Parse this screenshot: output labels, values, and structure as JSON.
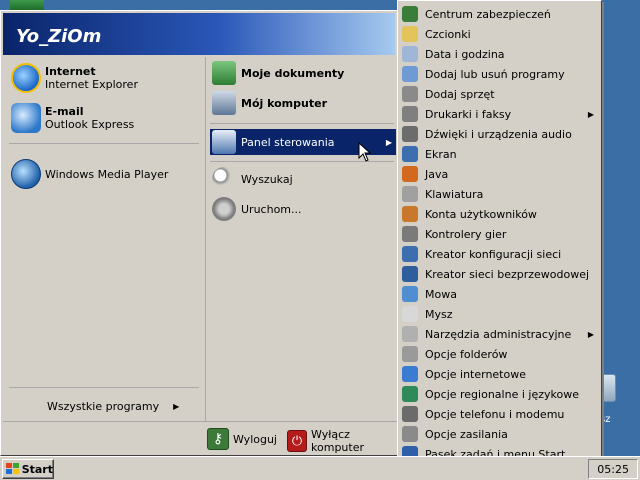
{
  "start_menu": {
    "user_name": "Yo_ZiOm",
    "pinned": [
      {
        "title": "Internet",
        "subtitle": "Internet Explorer",
        "icon": "internet-explorer-icon"
      },
      {
        "title": "E-mail",
        "subtitle": "Outlook Express",
        "icon": "outlook-express-icon"
      }
    ],
    "recent": [
      {
        "label": "Windows Media Player",
        "icon": "windows-media-player-icon"
      }
    ],
    "all_programs_label": "Wszystkie programy",
    "places": [
      {
        "label": "Moje dokumenty",
        "icon": "my-documents-icon",
        "bold": true
      },
      {
        "label": "Mój komputer",
        "icon": "my-computer-icon",
        "bold": true
      },
      {
        "label": "Panel sterowania",
        "icon": "control-panel-icon",
        "bold": false,
        "highlighted": true
      },
      {
        "label": "Wyszukaj",
        "icon": "search-icon",
        "bold": false
      },
      {
        "label": "Uruchom...",
        "icon": "run-icon",
        "bold": false
      }
    ],
    "footer": {
      "logoff_label": "Wyloguj",
      "shutdown_label": "Wyłącz komputer"
    }
  },
  "control_panel_submenu": {
    "items": [
      {
        "label": "Centrum zabezpieczeń",
        "icon": "security-center-icon",
        "color": "#3a7d3a",
        "has_submenu": false
      },
      {
        "label": "Czcionki",
        "icon": "fonts-folder-icon",
        "color": "#e3c45a",
        "has_submenu": false
      },
      {
        "label": "Data i godzina",
        "icon": "clock-icon",
        "color": "#9fb6d6",
        "has_submenu": false
      },
      {
        "label": "Dodaj lub usuń programy",
        "icon": "add-remove-programs-icon",
        "color": "#6e9bd3",
        "has_submenu": false
      },
      {
        "label": "Dodaj sprzęt",
        "icon": "add-hardware-icon",
        "color": "#8a8a8a",
        "has_submenu": false
      },
      {
        "label": "Drukarki i faksy",
        "icon": "printer-icon",
        "color": "#7f7f7f",
        "has_submenu": true
      },
      {
        "label": "Dźwięki i urządzenia audio",
        "icon": "speaker-icon",
        "color": "#6c6c6c",
        "has_submenu": false
      },
      {
        "label": "Ekran",
        "icon": "display-icon",
        "color": "#3d6fb0",
        "has_submenu": false
      },
      {
        "label": "Java",
        "icon": "java-icon",
        "color": "#d2691e",
        "has_submenu": false
      },
      {
        "label": "Klawiatura",
        "icon": "keyboard-icon",
        "color": "#a0a0a0",
        "has_submenu": false
      },
      {
        "label": "Konta użytkowników",
        "icon": "user-accounts-icon",
        "color": "#c9772b",
        "has_submenu": false
      },
      {
        "label": "Kontrolery gier",
        "icon": "game-controller-icon",
        "color": "#7a7a7a",
        "has_submenu": false
      },
      {
        "label": "Kreator konfiguracji sieci",
        "icon": "network-setup-icon",
        "color": "#3d6fb0",
        "has_submenu": false
      },
      {
        "label": "Kreator sieci bezprzewodowej",
        "icon": "wireless-network-icon",
        "color": "#2e5e9e",
        "has_submenu": false
      },
      {
        "label": "Mowa",
        "icon": "speech-icon",
        "color": "#4f8fd1",
        "has_submenu": false
      },
      {
        "label": "Mysz",
        "icon": "mouse-icon",
        "color": "#d8d8d8",
        "has_submenu": false
      },
      {
        "label": "Narzędzia administracyjne",
        "icon": "admin-tools-icon",
        "color": "#b0b0b0",
        "has_submenu": true
      },
      {
        "label": "Opcje folderów",
        "icon": "folder-options-icon",
        "color": "#9a9a9a",
        "has_submenu": false
      },
      {
        "label": "Opcje internetowe",
        "icon": "internet-options-icon",
        "color": "#3b7bd2",
        "has_submenu": false
      },
      {
        "label": "Opcje regionalne i językowe",
        "icon": "globe-icon",
        "color": "#2f8a5a",
        "has_submenu": false
      },
      {
        "label": "Opcje telefonu i modemu",
        "icon": "phone-icon",
        "color": "#6b6b6b",
        "has_submenu": false
      },
      {
        "label": "Opcje zasilania",
        "icon": "power-options-icon",
        "color": "#8a8a8a",
        "has_submenu": false
      },
      {
        "label": "Pasek zadań i menu Start",
        "icon": "taskbar-icon",
        "color": "#2f5fa8",
        "has_submenu": false
      }
    ],
    "more_indicator": "▾"
  },
  "taskbar": {
    "start_label": "Start",
    "clock": "05:25"
  },
  "desktop": {
    "icon_label_fragment": "sz"
  },
  "colors": {
    "highlight": "#0a246a",
    "desktop": "#3a6ea5",
    "face": "#d4d0c8"
  }
}
